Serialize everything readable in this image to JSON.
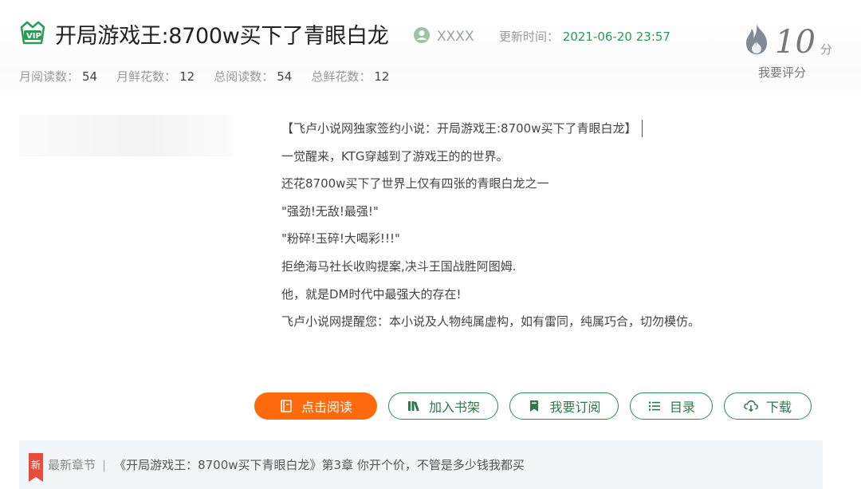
{
  "book": {
    "badge_text": "VIP",
    "title": "开局游戏王:8700w买下了青眼白龙",
    "author": "XXXX",
    "update_label": "更新时间：",
    "update_time": "2021-06-20 23:57"
  },
  "rating": {
    "score": "10",
    "unit": "分",
    "rate_label": "我要评分"
  },
  "stats": [
    {
      "label": "月阅读数：",
      "value": "54"
    },
    {
      "label": "月鲜花数：",
      "value": "12"
    },
    {
      "label": "总阅读数：",
      "value": "54"
    },
    {
      "label": "总鲜花数：",
      "value": "12"
    }
  ],
  "intro": [
    "【飞卢小说网独家签约小说：开局游戏王:8700w买下了青眼白龙】",
    "一觉醒来，KTG穿越到了游戏王的的世界。",
    "还花8700w买下了世界上仅有四张的青眼白龙之一",
    "\"强劲!无敌!最强!\"",
    "\"粉碎!玉碎!大喝彩!!!\"",
    "拒绝海马社长收购提案,决斗王国战胜阿图姆.",
    "他，就是DM时代中最强大的存在!",
    "飞卢小说网提醒您：本小说及人物纯属虚构，如有雷同，纯属巧合，切勿模仿。"
  ],
  "actions": {
    "read": "点击阅读",
    "shelf": "加入书架",
    "subscribe": "我要订阅",
    "catalog": "目录",
    "download": "下载"
  },
  "latest": {
    "tag": "新",
    "label": "最新章节",
    "separator": "|",
    "chapter": "《开局游戏王：8700w买下青眼白龙》第3章 你开个价，不管是多少钱我都买"
  },
  "colors": {
    "accent_green": "#2c9a57",
    "primary_orange": "#ff6a0c",
    "new_tag_red": "#e74c3c"
  }
}
